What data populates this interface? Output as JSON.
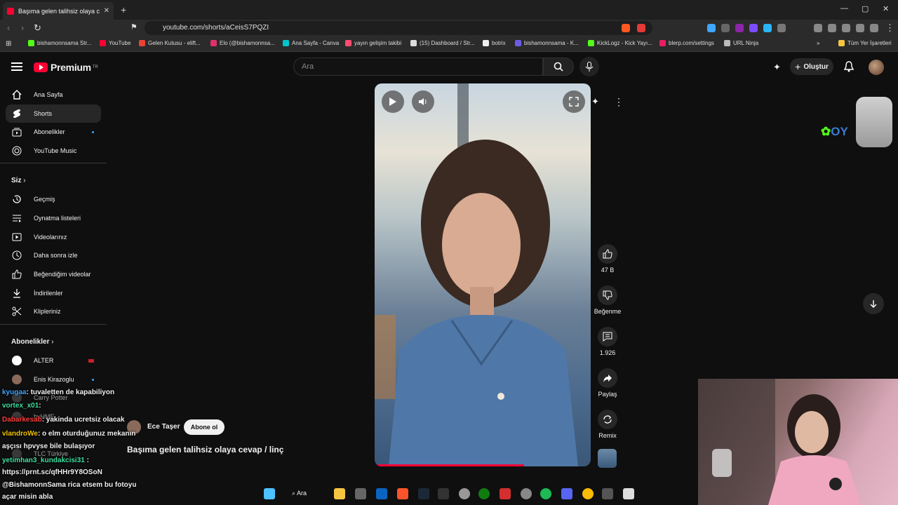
{
  "browser": {
    "tab_title": "Başıma gelen talihsiz olaya cevap / linç",
    "url": "youtube.com/shorts/aCeisS7PQZI",
    "bookmarks": [
      "bishamonnsama Str...",
      "YouTube",
      "Gelen Kutusu - elift...",
      "Elo (@bishamonnsa...",
      "Ana Sayfa - Canva",
      "yayın gelişim takibi",
      "(15) Dashboard / Str...",
      "botrix",
      "bishamonnsama - K...",
      "KickLogz - Kick Yayı...",
      "blerp.com/settings",
      "URL Ninja"
    ],
    "all_bookmarks": "Tüm Yer İşaretleri",
    "colors": {
      "youtube_red": "#ff0033",
      "accent_blue": "#3ea6ff"
    }
  },
  "header": {
    "logo_text": "Premium",
    "logo_region": "TR",
    "search_placeholder": "Ara",
    "create_label": "Oluştur"
  },
  "sidebar": {
    "main": [
      {
        "label": "Ana Sayfa",
        "icon": "home-icon"
      },
      {
        "label": "Shorts",
        "icon": "shorts-icon"
      },
      {
        "label": "Abonelikler",
        "icon": "subscriptions-icon"
      },
      {
        "label": "YouTube Music",
        "icon": "music-icon"
      }
    ],
    "you_header": "Siz",
    "you": [
      {
        "label": "Geçmiş",
        "icon": "history-icon"
      },
      {
        "label": "Oynatma listeleri",
        "icon": "playlists-icon"
      },
      {
        "label": "Videolarınız",
        "icon": "your-videos-icon"
      },
      {
        "label": "Daha sonra izle",
        "icon": "watch-later-icon"
      },
      {
        "label": "Beğendiğim videolar",
        "icon": "liked-icon"
      },
      {
        "label": "İndirilenler",
        "icon": "download-icon"
      },
      {
        "label": "Klipleriniz",
        "icon": "clips-icon"
      }
    ],
    "subs_header": "Abonelikler",
    "subs": [
      {
        "label": "ALTER"
      },
      {
        "label": "Enis Kirazoglu"
      },
      {
        "label": "Carry Potter"
      },
      {
        "label": "bvHME"
      },
      {
        "label": "TLC Türkiye"
      }
    ]
  },
  "short": {
    "channel": "Ece Taşer",
    "subscribe_label": "Abone ol",
    "title": "Başıma gelen talihsiz olaya cevap / linç",
    "likes": "47 B",
    "dislike_label": "Beğenme",
    "comments": "1.926",
    "share_label": "Paylaş",
    "remix_label": "Remix",
    "progress_fraction": 0.69
  },
  "chat": [
    {
      "user": "kyugaa",
      "color": "#3ea6ff",
      "msg": ": tuvaletten de kapabiliyon"
    },
    {
      "user": "vortex_x01",
      "color": "#3ee0a0",
      "msg": ":"
    },
    {
      "user": "Dabarkesab",
      "color": "#ff3b3b",
      "msg": ": yakinda ucretsiz olacak"
    },
    {
      "user": "vlandroWe",
      "color": "#f2c200",
      "msg": ": o elm oturduğunuz mekanın"
    },
    {
      "user": "",
      "color": "#ffffff",
      "msg": "aşçısı hpvyse bile bulaşıyor"
    },
    {
      "user": "yetimhan3_kundakcisi31",
      "color": "#3ee0a0",
      "msg": " :"
    },
    {
      "user": "",
      "color": "#ffffff",
      "msg": "https://prnt.sc/qfHHr9Y8OSoN"
    },
    {
      "user": "",
      "color": "#ffffff",
      "msg": "@BishamonnSama rica etsem bu fotoyu"
    },
    {
      "user": "",
      "color": "#ffffff",
      "msg": "açar misin abla"
    }
  ],
  "taskbar": {
    "search_label": "Ara"
  }
}
